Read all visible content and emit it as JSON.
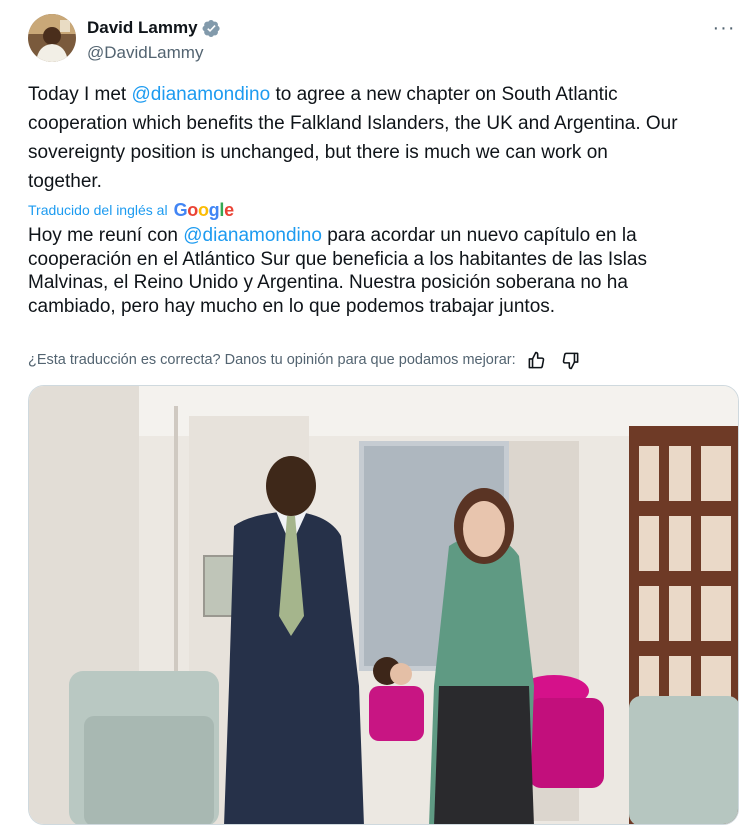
{
  "author": {
    "name": "David Lammy",
    "handle": "@DavidLammy",
    "avatar_icon": "profile-photo",
    "verified_icon": "verified-badge-icon",
    "verified_color": "#829aab"
  },
  "menu": {
    "more_icon": "more-horizontal-icon",
    "more_label": "···"
  },
  "tweet": {
    "original_prefix": "Today I met ",
    "original_mention": "@dianamondino",
    "original_suffix": " to agree a new chapter on South Atlantic\ncooperation which benefits the Falkland Islanders, the UK and Argentina. Our\nsovereignty position is unchanged, but there is much we can work on\ntogether.",
    "translated_by_label": "Traducido del inglés al",
    "translated_by_brand": "Google",
    "translation_prefix": "Hoy me reuní con ",
    "translation_mention": "@dianamondino",
    "translation_suffix": " para acordar un nuevo capítulo en la\ncooperación en el Atlántico Sur que beneficia a los habitantes de las Islas\nMalvinas, el Reino Unido y Argentina. Nuestra posición soberana no ha\ncambiado, pero hay mucho en lo que podemos trabajar juntos.",
    "feedback_prompt": "¿Esta traducción es correcta? Danos tu opinión para que podamos mejorar:",
    "thumbs_up_icon": "thumbs-up-icon",
    "thumbs_down_icon": "thumbs-down-icon"
  },
  "media": {
    "type": "photo"
  },
  "colors": {
    "link": "#1d9bf0",
    "secondary_text": "#536471",
    "primary_text": "#0f1419"
  }
}
